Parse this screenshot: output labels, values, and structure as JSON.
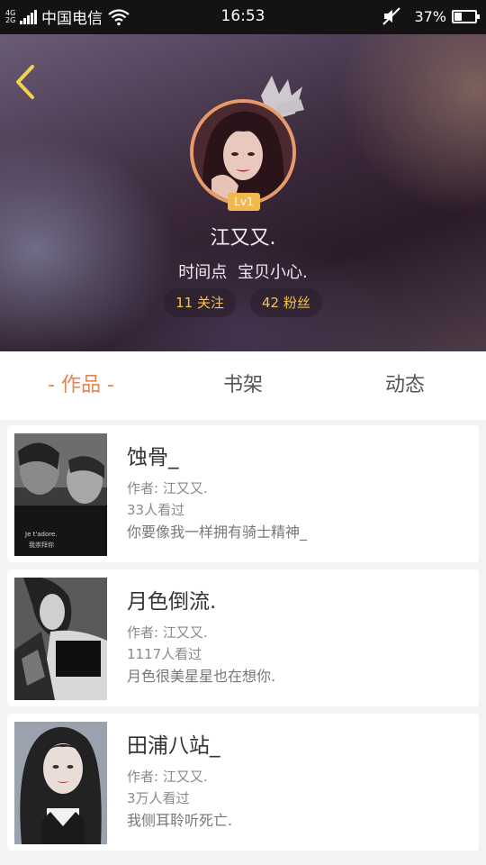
{
  "status_bar": {
    "network": [
      "4G",
      "2G"
    ],
    "carrier": "中国电信",
    "time": "16:53",
    "battery": "37%",
    "battery_level": 0.37
  },
  "profile": {
    "level": "Lv1",
    "name": "江又又.",
    "signature": "时间点  宝贝小心.",
    "following": "11 关注",
    "followers": "42 粉丝"
  },
  "tabs": [
    {
      "label": "- 作品 -",
      "active": true
    },
    {
      "label": "书架",
      "active": false
    },
    {
      "label": "动态",
      "active": false
    }
  ],
  "works": [
    {
      "title": "蚀骨_",
      "author": "作者: 江又又.",
      "views": "33人看过",
      "desc": "你要像我一样拥有骑士精神_",
      "cover_text": [
        "Je t'adore.",
        "我崇拜你"
      ]
    },
    {
      "title": "月色倒流.",
      "author": "作者: 江又又.",
      "views": "1117人看过",
      "desc": "月色很美星星也在想你."
    },
    {
      "title": "田浦八站_",
      "author": "作者: 江又又.",
      "views": "3万人看过",
      "desc": "我侧耳聆听死亡."
    }
  ],
  "colors": {
    "accent": "#e5844e",
    "gold": "#f3c44e",
    "level_badge": "#f1b84e"
  }
}
